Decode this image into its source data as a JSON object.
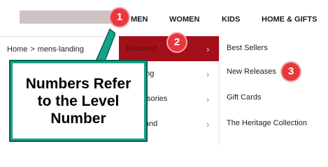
{
  "header": {
    "nav": [
      "MEN",
      "WOMEN",
      "KIDS",
      "HOME & GIFTS"
    ]
  },
  "breadcrumb": {
    "items": [
      "Home",
      "mens-landing"
    ],
    "separator": ">"
  },
  "menu_level2": {
    "items": [
      {
        "label": "Featured",
        "active": true
      },
      {
        "label": "Clothing"
      },
      {
        "label": "Accessories"
      },
      {
        "label": "By Brand"
      }
    ],
    "chevron": "›",
    "active_color": "#a4101a"
  },
  "menu_level3": {
    "items": [
      "Best Sellers",
      "New Releases",
      "Gift Cards",
      "The Heritage Collection"
    ]
  },
  "badges": [
    "1",
    "2",
    "3"
  ],
  "callout": {
    "lines": [
      "Numbers Refer",
      "to the Level",
      "Number"
    ],
    "color": "#13a48a"
  }
}
